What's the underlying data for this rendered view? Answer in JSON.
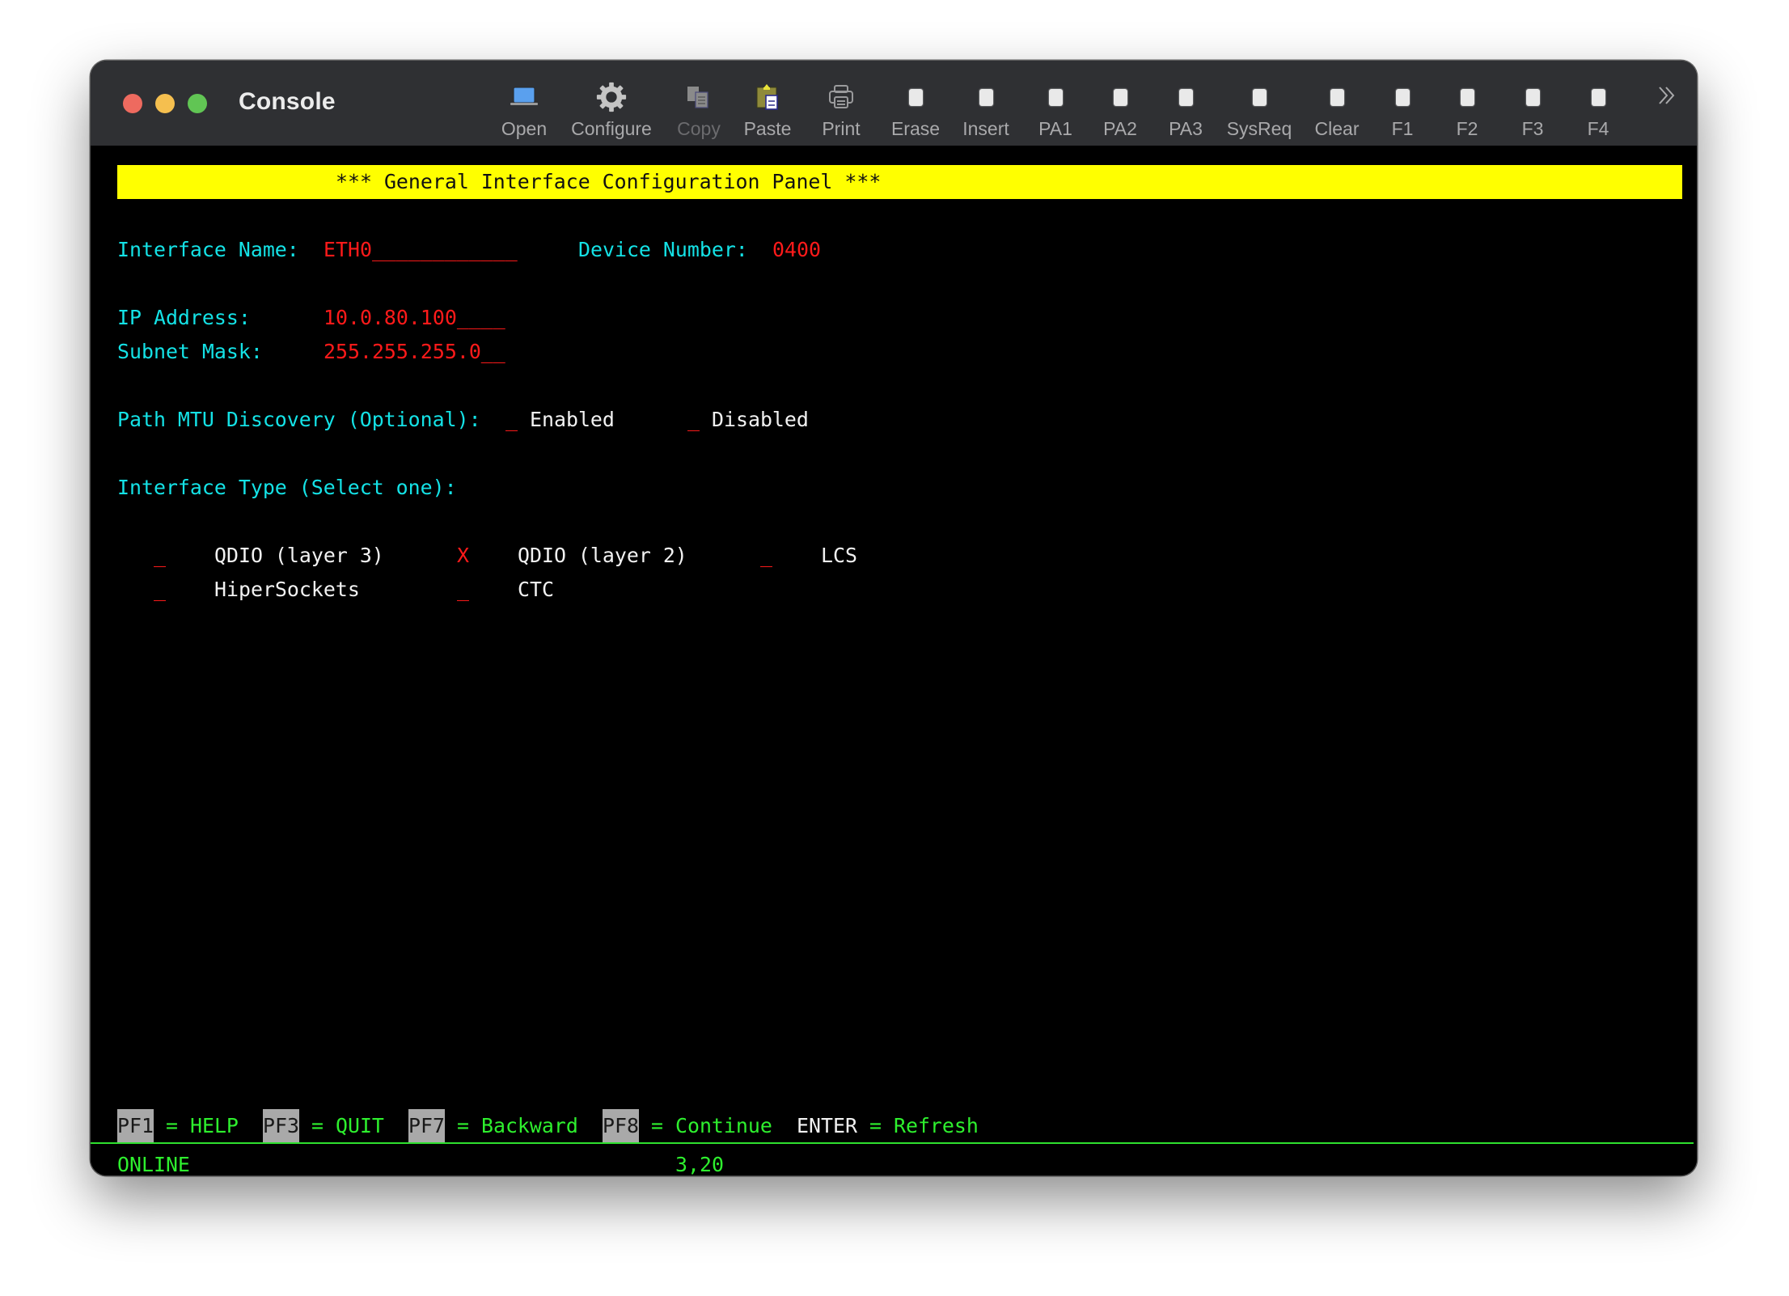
{
  "window": {
    "title": "Console"
  },
  "toolbar": {
    "items": [
      {
        "label": "Open",
        "icon": "laptop-icon",
        "enabled": true
      },
      {
        "label": "Configure",
        "icon": "gear-icon",
        "enabled": true
      },
      {
        "label": "Copy",
        "icon": "copy-icon",
        "enabled": false
      },
      {
        "label": "Paste",
        "icon": "paste-icon",
        "enabled": true
      },
      {
        "label": "Print",
        "icon": "printer-icon",
        "enabled": true
      },
      {
        "label": "Erase",
        "icon": "key-icon",
        "enabled": true
      },
      {
        "label": "Insert",
        "icon": "key-icon",
        "enabled": true
      },
      {
        "label": "PA1",
        "icon": "key-icon",
        "enabled": true
      },
      {
        "label": "PA2",
        "icon": "key-icon",
        "enabled": true
      },
      {
        "label": "PA3",
        "icon": "key-icon",
        "enabled": true
      },
      {
        "label": "SysReq",
        "icon": "key-icon",
        "enabled": true
      },
      {
        "label": "Clear",
        "icon": "key-icon",
        "enabled": true
      },
      {
        "label": "F1",
        "icon": "key-icon",
        "enabled": true
      },
      {
        "label": "F2",
        "icon": "key-icon",
        "enabled": true
      },
      {
        "label": "F3",
        "icon": "key-icon",
        "enabled": true
      },
      {
        "label": "F4",
        "icon": "key-icon",
        "enabled": true
      }
    ],
    "overflow_icon": "chevron-double-right-icon"
  },
  "terminal": {
    "banner": "*** General Interface Configuration Panel ***",
    "fields": {
      "interface_name_label": "Interface Name:",
      "interface_name_value": "ETH0____________",
      "device_number_label": "Device Number:",
      "device_number_value": "0400",
      "ip_address_label": "IP Address:",
      "ip_address_value": "10.0.80.100____",
      "subnet_mask_label": "Subnet Mask:",
      "subnet_mask_value": "255.255.255.0__"
    },
    "path_mtu": {
      "label": "Path MTU Discovery (Optional):",
      "options": [
        {
          "mark": "_",
          "label": "Enabled"
        },
        {
          "mark": "_",
          "label": "Disabled"
        }
      ]
    },
    "interface_type": {
      "label": "Interface Type (Select one):",
      "options": [
        {
          "mark": "_",
          "label": "QDIO (layer 3)",
          "selected": false
        },
        {
          "mark": "X",
          "label": "QDIO (layer 2)",
          "selected": true
        },
        {
          "mark": "_",
          "label": "LCS",
          "selected": false
        },
        {
          "mark": "_",
          "label": "HiperSockets",
          "selected": false
        },
        {
          "mark": "_",
          "label": "CTC",
          "selected": false
        }
      ]
    },
    "function_keys": [
      {
        "key": "PF1",
        "action": "= HELP"
      },
      {
        "key": "PF3",
        "action": "= QUIT"
      },
      {
        "key": "PF7",
        "action": "= Backward"
      },
      {
        "key": "PF8",
        "action": "= Continue"
      },
      {
        "key": "ENTER",
        "action": "= Refresh"
      }
    ],
    "status": {
      "state": "ONLINE",
      "cursor": "3,20"
    }
  },
  "colors": {
    "banner": "#ffff00",
    "label": "#14e2e6",
    "value": "#ff1a1a",
    "option_text": "#f2f2f2",
    "status": "#2ef02e",
    "pf_key_bg": "#a9a9a9"
  }
}
